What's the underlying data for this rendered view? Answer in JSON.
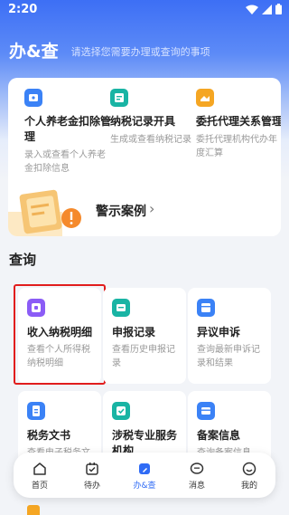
{
  "status_bar": {
    "time": "2:20"
  },
  "header": {
    "title": "办&查",
    "subtitle": "请选择您需要办理或查询的事项"
  },
  "services": [
    {
      "title": "个人养老金扣除管理",
      "desc": "录入或查看个人养老金扣除信息",
      "icon": "pension-icon",
      "color": "#3b82f6"
    },
    {
      "title": "纳税记录开具",
      "desc": "生成或查看纳税记录",
      "icon": "tax-record-icon",
      "color": "#19b4a4"
    },
    {
      "title": "委托代理关系管理",
      "desc": "委托代理机构代办年度汇算",
      "icon": "agent-icon",
      "color": "#f5a623"
    }
  ],
  "warning": {
    "label": "警示案例"
  },
  "query_section": {
    "title": "查询"
  },
  "queries": [
    {
      "title": "收入纳税明细",
      "desc": "查看个人所得税纳税明细",
      "icon": "income-icon",
      "color": "#8b5cf6"
    },
    {
      "title": "申报记录",
      "desc": "查看历史申报记录",
      "icon": "declare-icon",
      "color": "#19b4a4"
    },
    {
      "title": "异议申诉",
      "desc": "查询最新申诉记录和结果",
      "icon": "appeal-icon",
      "color": "#3b82f6"
    },
    {
      "title": "税务文书",
      "desc": "查看电子税务文书",
      "icon": "document-icon",
      "color": "#3b82f6"
    },
    {
      "title": "涉税专业服务机构",
      "desc": "",
      "icon": "service-org-icon",
      "color": "#19b4a4"
    },
    {
      "title": "备案信息",
      "desc": "查询备案信息",
      "icon": "filing-icon",
      "color": "#3b82f6"
    }
  ],
  "nav": [
    {
      "label": "首页",
      "icon": "home-icon"
    },
    {
      "label": "待办",
      "icon": "todo-icon"
    },
    {
      "label": "办&查",
      "icon": "handle-query-icon"
    },
    {
      "label": "消息",
      "icon": "message-icon"
    },
    {
      "label": "我的",
      "icon": "profile-icon"
    }
  ],
  "colors": {
    "brand": "#3d6ff5",
    "active_nav": "#2f6bf5",
    "highlight": "#e11d1d"
  }
}
